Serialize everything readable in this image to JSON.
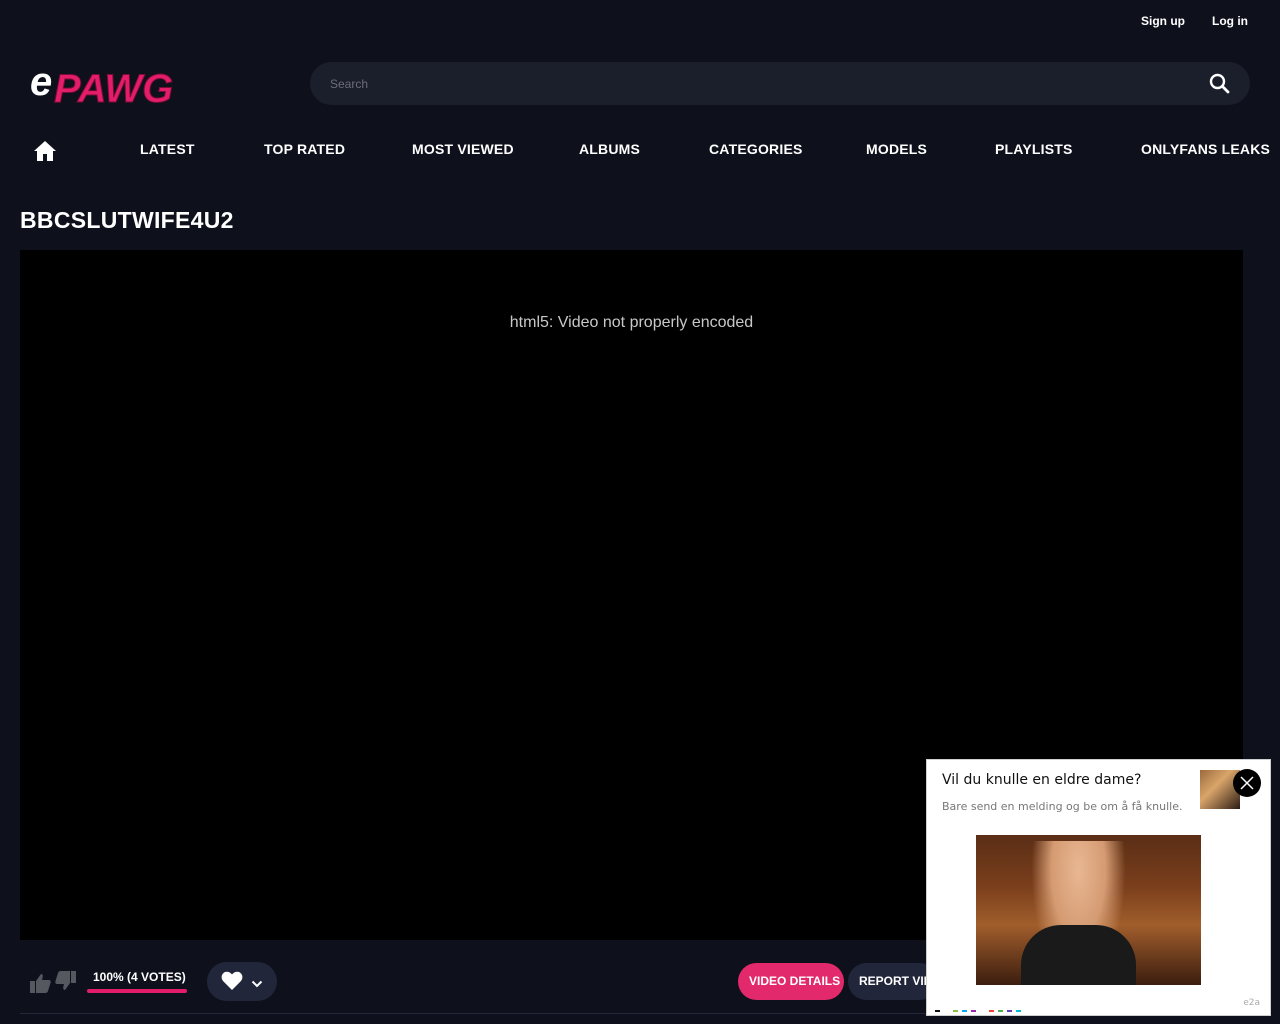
{
  "header": {
    "sign_up": "Sign up",
    "log_in": "Log in",
    "logo_text": "ePAWG",
    "search_placeholder": "Search"
  },
  "nav": {
    "items": [
      "LATEST",
      "TOP RATED",
      "MOST VIEWED",
      "ALBUMS",
      "CATEGORIES",
      "MODELS",
      "PLAYLISTS",
      "ONLYFANS LEAKS"
    ]
  },
  "video": {
    "title": "BBCSLUTWIFE4U2",
    "error_message": "html5: Video not properly encoded"
  },
  "actions": {
    "rating_text": "100% (4 VOTES)",
    "rating_percent": 100,
    "video_details": "VIDEO DETAILS",
    "report_video": "REPORT VIDEO"
  },
  "ad": {
    "title": "Vil du knulle en eldre dame?",
    "text": "Bare send en melding og be om å få knulle.",
    "footer": "e2a"
  },
  "colors": {
    "accent": "#e1296b",
    "background": "#0e111c",
    "search_bg": "#1b1e2b",
    "pill_bg": "#22263a"
  }
}
